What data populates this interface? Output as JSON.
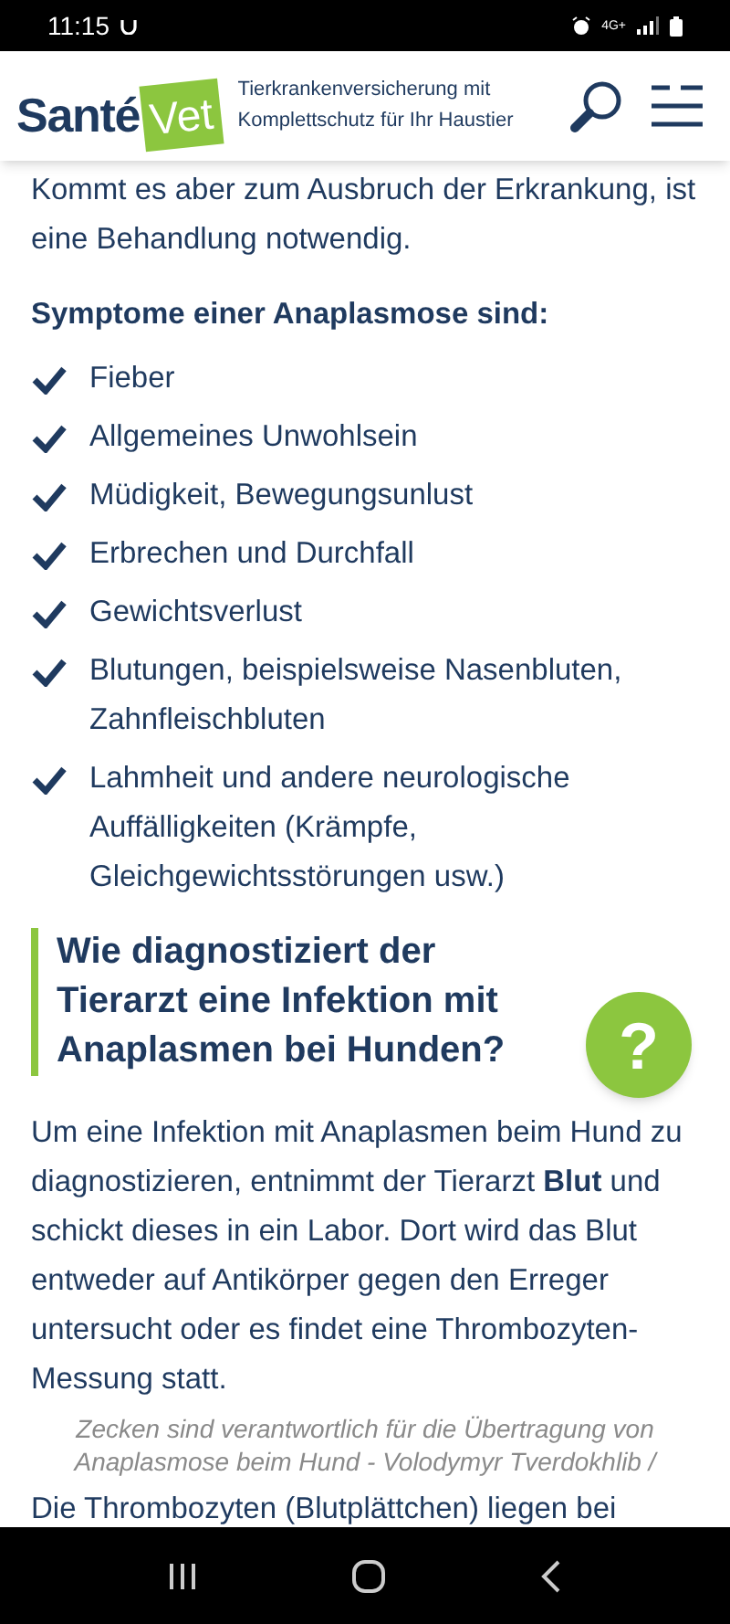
{
  "status_bar": {
    "time": "11:15",
    "network": "4G+"
  },
  "header": {
    "logo_left": "Santé",
    "logo_right": "Vet",
    "tagline": "Tierkrankenversicherung mit Komplettschutz für Ihr Haustier"
  },
  "intro": "Kommt es aber zum Ausbruch der Erkrankung, ist eine Behandlung notwendig.",
  "symptoms_title": "Symptome einer Anaplasmose sind:",
  "symptoms": [
    {
      "text": "Fieber"
    },
    {
      "text": "Allgemeines Unwohlsein"
    },
    {
      "text": "Müdigkeit, Bewegungsunlust"
    },
    {
      "text": "Erbrechen und Durchfall"
    },
    {
      "text": "Gewichtsverlust"
    },
    {
      "text": "Blutungen, beispielsweise Nasenbluten, Zahnfleischbluten"
    },
    {
      "text": "Lahmheit und andere neurologische Auffälligkeiten (Krämpfe, Gleichgewichtsstörungen usw.)"
    }
  ],
  "section_heading": "Wie diagnostiziert der Tierarzt eine Infektion mit Anaplasmen bei Hunden?",
  "paragraph": "Um eine Infektion mit Anaplasmen beim Hund zu diagnostizieren, entnimmt der Tierarzt **Blut** und schickt dieses in ein Labor. Dort wird das Blut entweder auf Antikörper gegen den Erreger untersucht oder es findet eine Thrombozyten-Messung statt.",
  "help_button": "?",
  "image_caption": "Zecken sind verantwortlich für die Übertragung von Anaplasmose beim Hund - Volodymyr Tverdokhlib /",
  "next_paragraph": "Die Thrombozyten (Blutplättchen) liegen bei"
}
